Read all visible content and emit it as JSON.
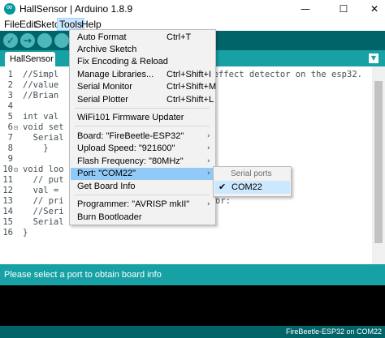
{
  "window": {
    "title": "HallSensor | Arduino 1.8.9",
    "minimize_glyph": "—",
    "maximize_glyph": "☐",
    "close_glyph": "✕"
  },
  "menubar": {
    "items": [
      "File",
      "Edit",
      "Sketch",
      "Tools",
      "Help"
    ],
    "active": "Tools"
  },
  "toolbar": {
    "buttons": [
      "verify-icon",
      "upload-icon",
      "new-icon",
      "open-icon",
      "save-icon"
    ],
    "glyphs": [
      "✓",
      "→",
      "",
      "",
      ""
    ]
  },
  "tab": {
    "label": "HallSensor",
    "menu_glyph": "▼"
  },
  "editor": {
    "lines": [
      {
        "num": "1",
        "fold": "",
        "text": "//Simpl"
      },
      {
        "num": "2",
        "fold": "",
        "text": "//value"
      },
      {
        "num": "3",
        "fold": "",
        "text": "//Brian"
      },
      {
        "num": "4",
        "fold": "",
        "text": ""
      },
      {
        "num": "5",
        "fold": "",
        "text": "int val"
      },
      {
        "num": "6",
        "fold": "⊟",
        "text": "void set"
      },
      {
        "num": "7",
        "fold": "",
        "text": "  Serial"
      },
      {
        "num": "8",
        "fold": "",
        "text": "    }"
      },
      {
        "num": "9",
        "fold": "",
        "text": ""
      },
      {
        "num": "10",
        "fold": "⊟",
        "text": "void loo"
      },
      {
        "num": "11",
        "fold": "",
        "text": "  // put"
      },
      {
        "num": "12",
        "fold": "",
        "text": "  val ="
      },
      {
        "num": "13",
        "fold": "",
        "text": "  // pri"
      },
      {
        "num": "14",
        "fold": "",
        "text": "  //Seri"
      },
      {
        "num": "15",
        "fold": "",
        "text": "  Serial"
      },
      {
        "num": "16",
        "fold": "",
        "text": "}"
      }
    ],
    "right_text_line1": "l effect detector on the esp32.",
    "right_text_line13": "or:"
  },
  "tools_menu": {
    "items": [
      {
        "label": "Auto Format",
        "shortcut": "Ctrl+T",
        "arrow": false
      },
      {
        "label": "Archive Sketch",
        "shortcut": "",
        "arrow": false
      },
      {
        "label": "Fix Encoding & Reload",
        "shortcut": "",
        "arrow": false
      },
      {
        "label": "Manage Libraries...",
        "shortcut": "Ctrl+Shift+I",
        "arrow": false
      },
      {
        "label": "Serial Monitor",
        "shortcut": "Ctrl+Shift+M",
        "arrow": false
      },
      {
        "label": "Serial Plotter",
        "shortcut": "Ctrl+Shift+L",
        "arrow": false
      },
      {
        "label": "WiFi101 Firmware Updater",
        "shortcut": "",
        "arrow": false
      },
      {
        "label": "Board: \"FireBeetle-ESP32\"",
        "shortcut": "",
        "arrow": true
      },
      {
        "label": "Upload Speed: \"921600\"",
        "shortcut": "",
        "arrow": true
      },
      {
        "label": "Flash Frequency: \"80MHz\"",
        "shortcut": "",
        "arrow": true
      },
      {
        "label": "Port: \"COM22\"",
        "shortcut": "",
        "arrow": true
      },
      {
        "label": "Get Board Info",
        "shortcut": "",
        "arrow": false
      },
      {
        "label": "Programmer: \"AVRISP mkII\"",
        "shortcut": "",
        "arrow": true
      },
      {
        "label": "Burn Bootloader",
        "shortcut": "",
        "arrow": false
      }
    ],
    "arrow_glyph": "›"
  },
  "port_submenu": {
    "header": "Serial ports",
    "item": "COM22",
    "check_glyph": "✔"
  },
  "status": {
    "message": "Please select a port to obtain board info",
    "board_port": "FireBeetle-ESP32 on COM22"
  },
  "colors": {
    "toolbar": "#006468",
    "tab_row": "#17a1a5",
    "highlight": "#91c9f7"
  }
}
